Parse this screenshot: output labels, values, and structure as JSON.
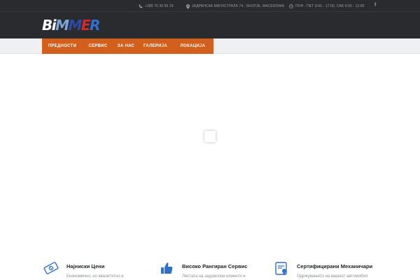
{
  "topbar": {
    "phone": "+389 70 30 55 29",
    "address": "ЈАДРАНСКА МАГИСТРАЛА 74 , SKOPJE, MACEDONIA",
    "hours": "ПОН - ПЕТ 9:00 - 17:00, САБ 9:00 - 13:00",
    "social": "f"
  },
  "logo": {
    "letters": [
      "B",
      "i",
      "M",
      "M",
      "E",
      "R"
    ]
  },
  "nav": {
    "items": [
      "ПРЕДНОСТИ",
      "СЕРВИС",
      "ЗА НАС",
      "ГАЛЕРИЈА",
      "ЛОКАЦИЈА"
    ]
  },
  "features": [
    {
      "title": "Најниски Цени",
      "desc": "Економично, но квалитетно е",
      "icon": "money-icon"
    },
    {
      "title": "Високо Рангиран Сервис",
      "desc": "Листата на задоволни клиенти и",
      "icon": "thumbs-up-icon"
    },
    {
      "title": "Сертифицирани Механичари",
      "desc": "Одржувањето на вашиот автомобил",
      "icon": "certificate-icon"
    }
  ],
  "colors": {
    "header_bg": "#2a2b2f",
    "nav_bg": "#d35f1d",
    "accent_blue": "#2f6fcf"
  }
}
